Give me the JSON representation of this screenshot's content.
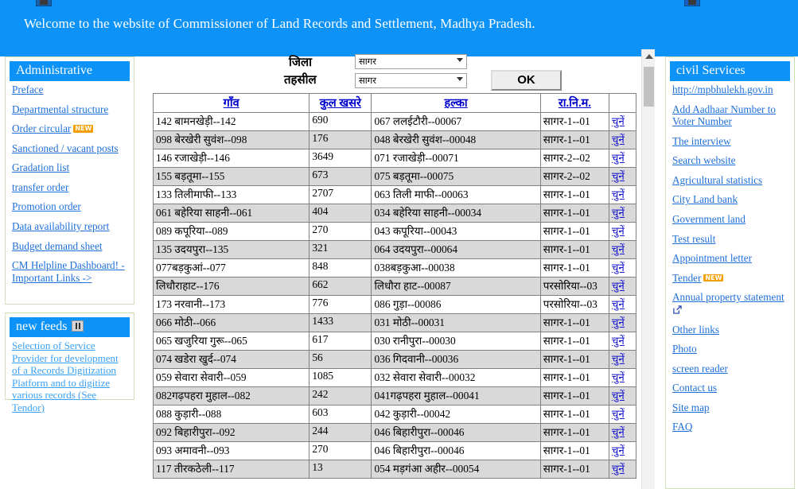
{
  "banner": {
    "text": "Welcome to the website of Commissioner of Land Records and Settlement, Madhya Pradesh.",
    "bg_color": "#0d92f7",
    "left_icon": "image-placeholder-icon",
    "right_icon": "image-placeholder-icon"
  },
  "left_sidebar": {
    "administrative": {
      "title": "Administrative",
      "items": [
        {
          "label": "Preface",
          "badge": ""
        },
        {
          "label": "Departmental structure",
          "badge": ""
        },
        {
          "label": "Order circular",
          "badge": "NEW"
        },
        {
          "label": "Sanctioned / vacant posts",
          "badge": ""
        },
        {
          "label": "Gradation list",
          "badge": ""
        },
        {
          "label": "transfer order",
          "badge": ""
        },
        {
          "label": "Promotion order",
          "badge": ""
        },
        {
          "label": "Data availability report",
          "badge": ""
        },
        {
          "label": "Budget demand sheet",
          "badge": ""
        },
        {
          "label": "CM Helpline Dashboard! - Important Links ->",
          "badge": ""
        }
      ]
    },
    "new_feeds": {
      "title": "new feeds",
      "pause_icon": "pause-icon",
      "feed_text": "Selection of Service Provider for development of a Records Digitization Platform and to digitize various records (See Tendor)"
    }
  },
  "right_sidebar": {
    "title": "civil Services",
    "items": [
      {
        "label": "http://mpbhulekh.gov.in",
        "badge": ""
      },
      {
        "label": "Add Aadhaar Number to Voter Number",
        "badge": ""
      },
      {
        "label": "The interview",
        "badge": ""
      },
      {
        "label": "Search website",
        "badge": ""
      },
      {
        "label": "Agricultural statistics",
        "badge": ""
      },
      {
        "label": "City Land bank",
        "badge": ""
      },
      {
        "label": "Government land",
        "badge": ""
      },
      {
        "label": "Test result",
        "badge": ""
      },
      {
        "label": "Appointment letter",
        "badge": ""
      },
      {
        "label": "Tender",
        "badge": "NEW"
      },
      {
        "label": "Annual property statement",
        "badge": "",
        "external": true
      },
      {
        "label": "Other links",
        "badge": ""
      },
      {
        "label": "Photo",
        "badge": ""
      },
      {
        "label": "screen reader",
        "badge": ""
      },
      {
        "label": "Contact us",
        "badge": ""
      },
      {
        "label": "Site map",
        "badge": ""
      },
      {
        "label": "FAQ",
        "badge": ""
      }
    ]
  },
  "controls": {
    "district_label": "जिला",
    "district_value": "सागर",
    "tehsil_label": "तहसील",
    "tehsil_value": "सागर",
    "ok_label": "OK"
  },
  "table": {
    "headers": [
      "गाँव",
      "कुल खसरे",
      "हल्का",
      "रा.नि.म.",
      ""
    ],
    "select_label": "चुनें",
    "rows": [
      {
        "gaon": "142 बामनखेड़ी--142",
        "khasre": "690",
        "halka": "067 ललईटौरी--00067",
        "ranim": "सागर-1--01"
      },
      {
        "gaon": "098 बेरखेरी सुवंश--098",
        "khasre": "176",
        "halka": "048 बेरखेरी सुवंश--00048",
        "ranim": "सागर-1--01"
      },
      {
        "gaon": "146 रजाखेड़ी--146",
        "khasre": "3649",
        "halka": "071 रजाखेड़ी--00071",
        "ranim": "सागर-2--02"
      },
      {
        "gaon": "155 बड़तूमा--155",
        "khasre": "673",
        "halka": "075 बड़तूमा--00075",
        "ranim": "सागर-2--02"
      },
      {
        "gaon": "133 तिलीमाफी--133",
        "khasre": "2707",
        "halka": "063 तिली माफी--00063",
        "ranim": "सागर-1--01"
      },
      {
        "gaon": "061 बहेरिया साहनी--061",
        "khasre": "404",
        "halka": "034 बहेरिया साहनी--00034",
        "ranim": "सागर-1--01"
      },
      {
        "gaon": "089 कपूरिया--089",
        "khasre": "270",
        "halka": "043 कपूरिया--00043",
        "ranim": "सागर-1--01"
      },
      {
        "gaon": "135 उदयपुरा--135",
        "khasre": "321",
        "halka": "064 उदयपुरा--00064",
        "ranim": "सागर-1--01"
      },
      {
        "gaon": "077बड़कुआं--077",
        "khasre": "848",
        "halka": "038बड़कुआ--00038",
        "ranim": "सागर-1--01"
      },
      {
        "gaon": "लिधौराहाट--176",
        "khasre": "662",
        "halka": "लिधौरा हाट--00087",
        "ranim": "परसोरिया--03"
      },
      {
        "gaon": "173 नरवानी--173",
        "khasre": "776",
        "halka": "086 गुड़ा--00086",
        "ranim": "परसोरिया--03"
      },
      {
        "gaon": "066 मोठी--066",
        "khasre": "1433",
        "halka": "031 मोठी--00031",
        "ranim": "सागर-1--01"
      },
      {
        "gaon": "065 खजुरिया गुरू--065",
        "khasre": "617",
        "halka": "030 रानीपुरा--00030",
        "ranim": "सागर-1--01"
      },
      {
        "gaon": "074 खडेरा खुर्द--074",
        "khasre": "56",
        "halka": "036 गिदवानी--00036",
        "ranim": "सागर-1--01"
      },
      {
        "gaon": "059 सेवारा सेवारी--059",
        "khasre": "1085",
        "halka": "032 सेवारा सेवारी--00032",
        "ranim": "सागर-1--01"
      },
      {
        "gaon": "082गढ़पहरा मुहाल--082",
        "khasre": "242",
        "halka": "041गढ़पहरा मुहाल--00041",
        "ranim": "सागर-1--01"
      },
      {
        "gaon": "088 कुड़ारी--088",
        "khasre": "603",
        "halka": "042 कुड़ारी--00042",
        "ranim": "सागर-1--01"
      },
      {
        "gaon": "092 बिहारीपुरा--092",
        "khasre": "244",
        "halka": "046 बिहारीपुरा--00046",
        "ranim": "सागर-1--01"
      },
      {
        "gaon": "093 अमावनी--093",
        "khasre": "270",
        "halka": "046 बिहारीपुरा--00046",
        "ranim": "सागर-1--01"
      },
      {
        "gaon": "117 तीरकठेली--117",
        "khasre": "13",
        "halka": "054 मड़गंआ अहीर--00054",
        "ranim": "सागर-1--01"
      }
    ]
  },
  "scrollbar": {
    "up_arrow_icon": "triangle-up-icon",
    "thumb": "scroll-thumb"
  }
}
